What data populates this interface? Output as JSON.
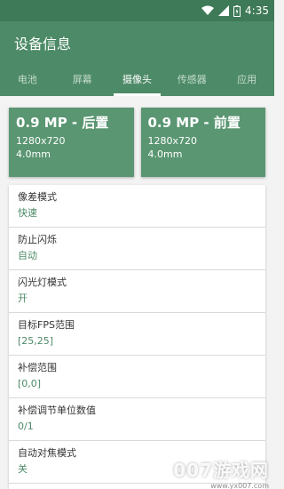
{
  "status": {
    "time": "4:35"
  },
  "appbar": {
    "title": "设备信息"
  },
  "tabs": [
    {
      "label": "电池"
    },
    {
      "label": "屏幕"
    },
    {
      "label": "摄像头"
    },
    {
      "label": "传感器"
    },
    {
      "label": "应用"
    }
  ],
  "cameras": [
    {
      "title": "0.9 MP - 后置",
      "resolution": "1280x720",
      "focal": "4.0mm"
    },
    {
      "title": "0.9 MP - 前置",
      "resolution": "1280x720",
      "focal": "4.0mm"
    }
  ],
  "properties": [
    {
      "label": "像差模式",
      "value": "快速"
    },
    {
      "label": "防止闪烁",
      "value": "自动"
    },
    {
      "label": "闪光灯模式",
      "value": "开"
    },
    {
      "label": "目标FPS范围",
      "value": "[25,25]"
    },
    {
      "label": "补偿范围",
      "value": "[0,0]"
    },
    {
      "label": "补偿调节单位数值",
      "value": "0/1"
    },
    {
      "label": "自动对焦模式",
      "value": "关"
    }
  ],
  "watermark": {
    "text": "007游戏网",
    "sub": "www.yx007.com"
  },
  "colors": {
    "primary": "#4d8a67",
    "statusbar": "#3f7a58",
    "card": "#5a9672"
  }
}
